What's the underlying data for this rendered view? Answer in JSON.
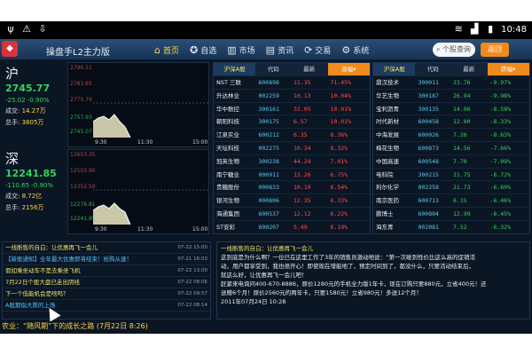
{
  "status": {
    "left_icons": [
      "usb-icon",
      "warning-icon",
      "download-icon"
    ],
    "time": "10:48"
  },
  "app": {
    "title": "操盘手L2主力版",
    "nav": [
      {
        "label": "首页",
        "icon": "home-icon",
        "active": true
      },
      {
        "label": "自选",
        "icon": "star-icon",
        "active": false
      },
      {
        "label": "市场",
        "icon": "chart-icon",
        "active": false
      },
      {
        "label": "资讯",
        "icon": "news-icon",
        "active": false
      },
      {
        "label": "交易",
        "icon": "trade-icon",
        "active": false
      },
      {
        "label": "系统",
        "icon": "gear-icon",
        "active": false
      }
    ],
    "search_placeholder": "个股查询",
    "return_label": "返回"
  },
  "indices": [
    {
      "name": "沪",
      "value": "2745.77",
      "change": "-25.02",
      "pct": "-0.90%",
      "turnover_label": "成交:",
      "turnover": "14.27万",
      "amount_label": "总手:",
      "amount": "3805万",
      "axis_top": [
        "2796.51",
        "2783.65",
        "2770.79"
      ],
      "axis_bottom": [
        "2757.93",
        "2745.07"
      ],
      "times": [
        "9:30",
        "11:30",
        "15:00"
      ]
    },
    {
      "name": "深",
      "value": "12241.85",
      "change": "-110.65",
      "pct": "-0.90%",
      "turnover_label": "成交:",
      "turnover": "8.72亿",
      "amount_label": "总手:",
      "amount": "2156万",
      "axis_top": [
        "12653.35",
        "12503.90",
        "12352.50"
      ],
      "axis_bottom": [
        "12276.81",
        "12241.85"
      ],
      "times": [
        "9:30",
        "11:30",
        "15:00"
      ]
    }
  ],
  "table_left": {
    "tab": "沪深A股",
    "headers": [
      "代码",
      "最新",
      "涨幅"
    ],
    "rows": [
      [
        "NST 三联",
        "600898",
        "11.35",
        "71.45%"
      ],
      [
        "升达林业",
        "002259",
        "10.13",
        "10.04%"
      ],
      [
        "华中数控",
        "300161",
        "32.05",
        "10.01%"
      ],
      [
        "朝阳科技",
        "300175",
        "6.57",
        "10.01%"
      ],
      [
        "江泉实业",
        "600212",
        "6.35",
        "8.36%"
      ],
      [
        "天坛科技",
        "002275",
        "10.34",
        "8.32%"
      ],
      [
        "冠英生物",
        "300238",
        "44.24",
        "7.01%"
      ],
      [
        "南宁糖业",
        "000911",
        "13.26",
        "6.75%"
      ],
      [
        "贵糖股份",
        "000833",
        "10.10",
        "6.54%"
      ],
      [
        "银河生物",
        "000806",
        "12.35",
        "6.33%"
      ],
      [
        "海通集团",
        "600537",
        "12.12",
        "6.22%"
      ],
      [
        "ST安彩",
        "600207",
        "5.49",
        "6.19%"
      ]
    ]
  },
  "table_right": {
    "tab": "沪深A股",
    "headers": [
      "代码",
      "最新",
      "跌幅"
    ],
    "rows": [
      [
        "鼎汉技术",
        "300011",
        "23.76",
        "-9.97%"
      ],
      [
        "华艺生物",
        "300187",
        "26.94",
        "-9.98%"
      ],
      [
        "宝利沥青",
        "300135",
        "14.06",
        "-8.58%"
      ],
      [
        "时代新材",
        "600458",
        "12.00",
        "-8.33%"
      ],
      [
        "中海发展",
        "600026",
        "7.26",
        "-8.63%"
      ],
      [
        "梅花生物",
        "600873",
        "14.56",
        "-7.66%"
      ],
      [
        "中国高速",
        "600548",
        "7.70",
        "-7.09%"
      ],
      [
        "电科院",
        "300215",
        "21.75",
        "-6.72%"
      ],
      [
        "利尔化学",
        "002258",
        "21.73",
        "-6.60%"
      ],
      [
        "南京医药",
        "600713",
        "6.15",
        "-6.46%"
      ],
      [
        "鹏博士",
        "600804",
        "12.99",
        "-6.45%"
      ],
      [
        "海东青",
        "002081",
        "7.52",
        "-6.32%"
      ]
    ]
  },
  "news": {
    "header": "一线断售的自白：让优惠再飞一会儿",
    "header_date": "07-22 15:00",
    "items": [
      {
        "text": "【新股通知】全年最大优惠即将结束！抢购从速！",
        "date": "07-21 16:03"
      },
      {
        "text": "假如乘坐动车不是去乘坐飞机",
        "date": "07-22 13:00"
      },
      {
        "text": "7月22日个股大盘已走出阴线",
        "date": "07-22 08:06"
      },
      {
        "text": "下一个低能机会是啥吗？",
        "date": "07-22 09:57"
      },
      {
        "text": "A股期指大跌的上场",
        "date": "07-22 08:14"
      }
    ]
  },
  "article": {
    "title": "一线断售的自白：让优惠再飞一会儿",
    "lines": [
      "这到底是为什么啊？一位已在这里工作了3年的销售员激动地说：“第一次碰到性价比这么高的促销活",
      "动，用户都享受到，我也很开心！即使现在增能地了，预定时间到了，都没什么，只要活动结束后，",
      "就这么好，让优惠再飞一会儿吧！",
      "赶紧来电询问400-670-8886，原价1280元的手机全力版1年卡，现在订购只要880元，立省400元！还",
      "送赠6个月！原价2560元的两年卡，只要1580元！立省980元！多送12个月！",
      "2011年07月24日 10:28"
    ]
  },
  "ticker": "农业：“随风期”下的成长之路 (7月22日 8:26)"
}
